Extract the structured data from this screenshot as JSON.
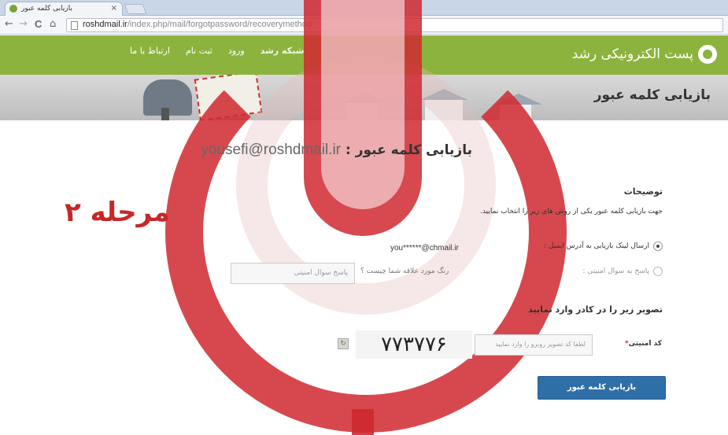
{
  "browser": {
    "tab_title": "بازیابی کلمه عبور",
    "tab_close": "×",
    "url_host": "roshdmail.ir",
    "url_path": "/index.php/mail/forgotpassword/recoverymethod",
    "back_icon": "←",
    "forward_icon": "→",
    "reload_icon": "C",
    "home_icon": "⌂"
  },
  "header": {
    "brand": "پست الکترونیکی رشد",
    "nav": [
      "شبکه رشد",
      "ورود",
      "ثبت نام",
      "ارتباط با ما"
    ]
  },
  "banner": {
    "title": "بازیابی کلمه عبور"
  },
  "annotation": {
    "step": "مرحله ۲"
  },
  "main": {
    "heading_label": "بازیابی کلمه عبور :",
    "heading_email": "yousefi@roshdmail.ir",
    "description_title": "توضیحات",
    "description_text": "جهت بازیابی کلمه عبور یکی از روش های زیر را انتخاب نمایید.",
    "option_email_label": "ارسال لینک بازیابی به آدرس ایمیل :",
    "option_email_value": "you******@chmail.ir",
    "option_question_label": "پاسخ به سوال امنیتی :",
    "security_question": "رنگ مورد علاقه شما چیست ؟",
    "answer_placeholder": "پاسخ سوال امنیتی",
    "captcha_title": "تصویر زیر را در کادر وارد نمایید",
    "captcha_label": "کد امنیتی",
    "captcha_required": "*",
    "captcha_placeholder": "لطفا کد تصویر روبرو را وارد نمایید",
    "captcha_text": "۷۷۳۷۷۶",
    "submit": "بازیابی کلمه عبور"
  },
  "colors": {
    "header_green": "#8cb33d",
    "button_blue": "#2f6fa8",
    "step_red": "#c62828"
  }
}
